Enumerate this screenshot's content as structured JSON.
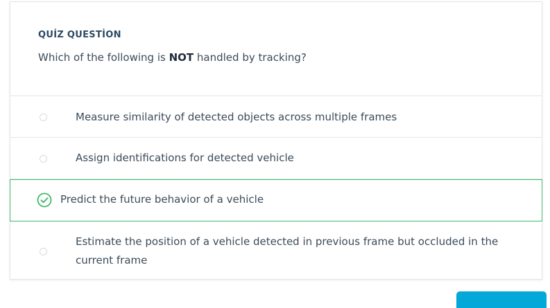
{
  "quiz": {
    "eyebrow": "QUİZ QUESTİON",
    "question_prefix": "Which of the following is ",
    "question_emphasis": "NOT",
    "question_suffix": " handled by tracking?",
    "options": [
      {
        "label": "Measure similarity of detected objects across multiple frames",
        "selected": false
      },
      {
        "label": "Assign identifications for detected vehicle",
        "selected": false
      },
      {
        "label": "Predict the future behavior of a vehicle",
        "selected": true,
        "status": "correct"
      },
      {
        "label": "Estimate the position of a vehicle detected in previous frame but occluded in the current frame",
        "selected": false
      }
    ]
  },
  "colors": {
    "correct": "#3fb96a",
    "accent_button": "#02a9d8",
    "eyebrow": "#2c4a63"
  },
  "icons": {
    "correct": "check-circle-icon",
    "unselected": "radio-empty-icon"
  }
}
